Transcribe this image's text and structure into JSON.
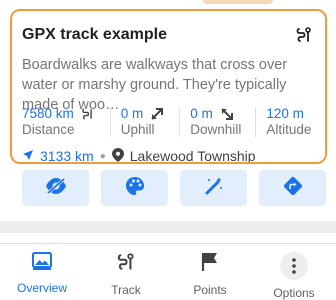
{
  "card": {
    "title": "GPX track example",
    "description": "Boardwalks are walkways that cross over water or marshy ground. They're typically made of woo…"
  },
  "stats": [
    {
      "value": "7580 km",
      "label": "Distance",
      "icon": "track-icon"
    },
    {
      "value": "0 m",
      "label": "Uphill",
      "icon": "uphill-icon"
    },
    {
      "value": "0 m",
      "label": "Downhill",
      "icon": "downhill-icon"
    },
    {
      "value": "120 m",
      "label": "Altitude",
      "icon": "altitude-icon"
    }
  ],
  "meta": {
    "distance": "3133 km",
    "location": "Lakewood Township"
  },
  "actions": [
    {
      "name": "hide-button",
      "icon": "eye-off-icon"
    },
    {
      "name": "appearance-button",
      "icon": "palette-icon"
    },
    {
      "name": "edit-button",
      "icon": "wand-icon"
    },
    {
      "name": "navigate-button",
      "icon": "directions-icon"
    }
  ],
  "tabs": [
    {
      "label": "Overview",
      "icon": "image-icon",
      "active": true
    },
    {
      "label": "Track",
      "icon": "track-icon",
      "active": false
    },
    {
      "label": "Points",
      "icon": "flag-icon",
      "active": false
    },
    {
      "label": "Options",
      "icon": "more-vertical-icon",
      "active": false
    }
  ],
  "colors": {
    "accent": "#1a73e8",
    "card_border": "#f29a3c",
    "action_bg": "#e3eefc",
    "text_secondary": "#757575"
  }
}
